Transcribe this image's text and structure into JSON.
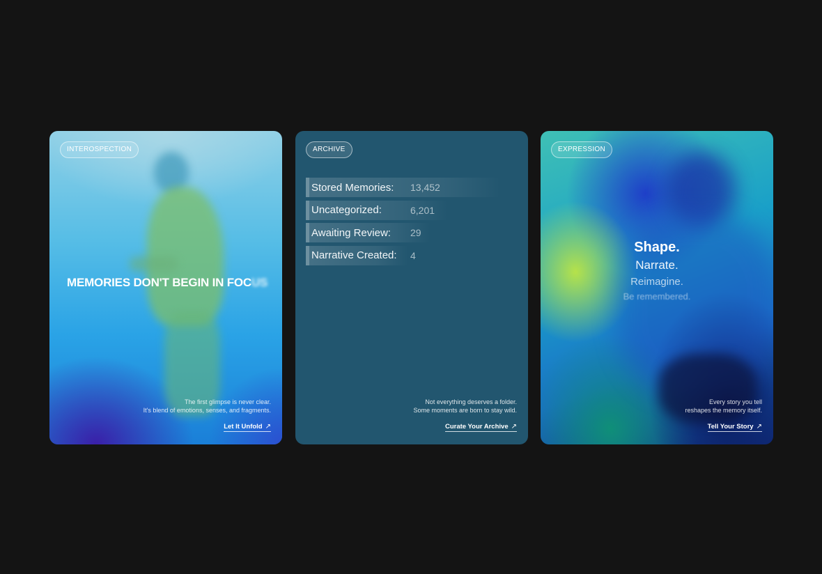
{
  "cards": [
    {
      "tag": "INTEROSPECTION",
      "headline_main": "MEMORIES DON'T BEGIN IN FOC",
      "headline_faded": "US",
      "description": [
        "The first glimpse is never clear.",
        "It's blend of emotions, senses, and fragments."
      ],
      "cta": "Let It Unfold",
      "cta_icon": "arrow-up-right-icon"
    },
    {
      "tag": "ARCHIVE",
      "stats": [
        {
          "label": "Stored Memories:",
          "value": "13,452",
          "bar_fraction": 1.0
        },
        {
          "label": "Uncategorized:",
          "value": "6,201",
          "bar_fraction": 0.46
        },
        {
          "label": "Awaiting Review:",
          "value": "29",
          "bar_fraction": 0.28
        },
        {
          "label": "Narrative Created:",
          "value": "4",
          "bar_fraction": 0.05
        }
      ],
      "description": [
        "Not everything deserves a folder.",
        "Some moments are born to stay wild."
      ],
      "cta": "Curate Your Archive",
      "cta_icon": "arrow-up-right-icon"
    },
    {
      "tag": "EXPRESSION",
      "words": [
        "Shape.",
        "Narrate.",
        "Reimagine.",
        "Be remembered."
      ],
      "description": [
        "Every story you tell",
        "reshapes the memory itself."
      ],
      "cta": "Tell Your Story",
      "cta_icon": "arrow-up-right-icon"
    }
  ],
  "colors": {
    "page_background": "#141414",
    "archive_card": "#22566f"
  }
}
